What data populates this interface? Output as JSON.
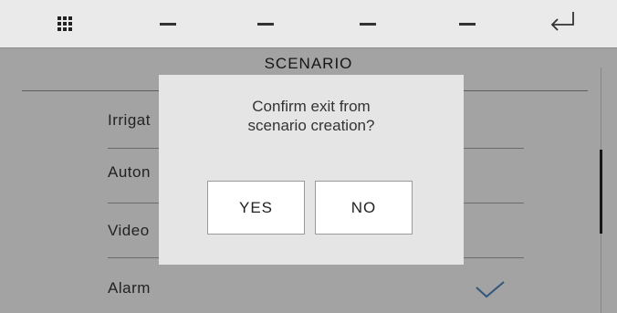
{
  "topbar": {
    "icons": [
      "grid-menu-icon",
      "dash-icon",
      "dash-icon",
      "dash-icon",
      "dash-icon",
      "back-arrow-icon"
    ]
  },
  "screen": {
    "title": "SCENARIO",
    "items": [
      {
        "label": "Irrigat"
      },
      {
        "label": "Auton"
      },
      {
        "label": "Video"
      },
      {
        "label": "Alarm",
        "checked": true
      }
    ]
  },
  "dialog": {
    "message_line1": "Confirm exit from",
    "message_line2": "scenario creation?",
    "yes_label": "YES",
    "no_label": "NO"
  },
  "colors": {
    "background": "#f0f0f0",
    "dialog": "#e5e5e5",
    "check": "#4a7fb8"
  }
}
